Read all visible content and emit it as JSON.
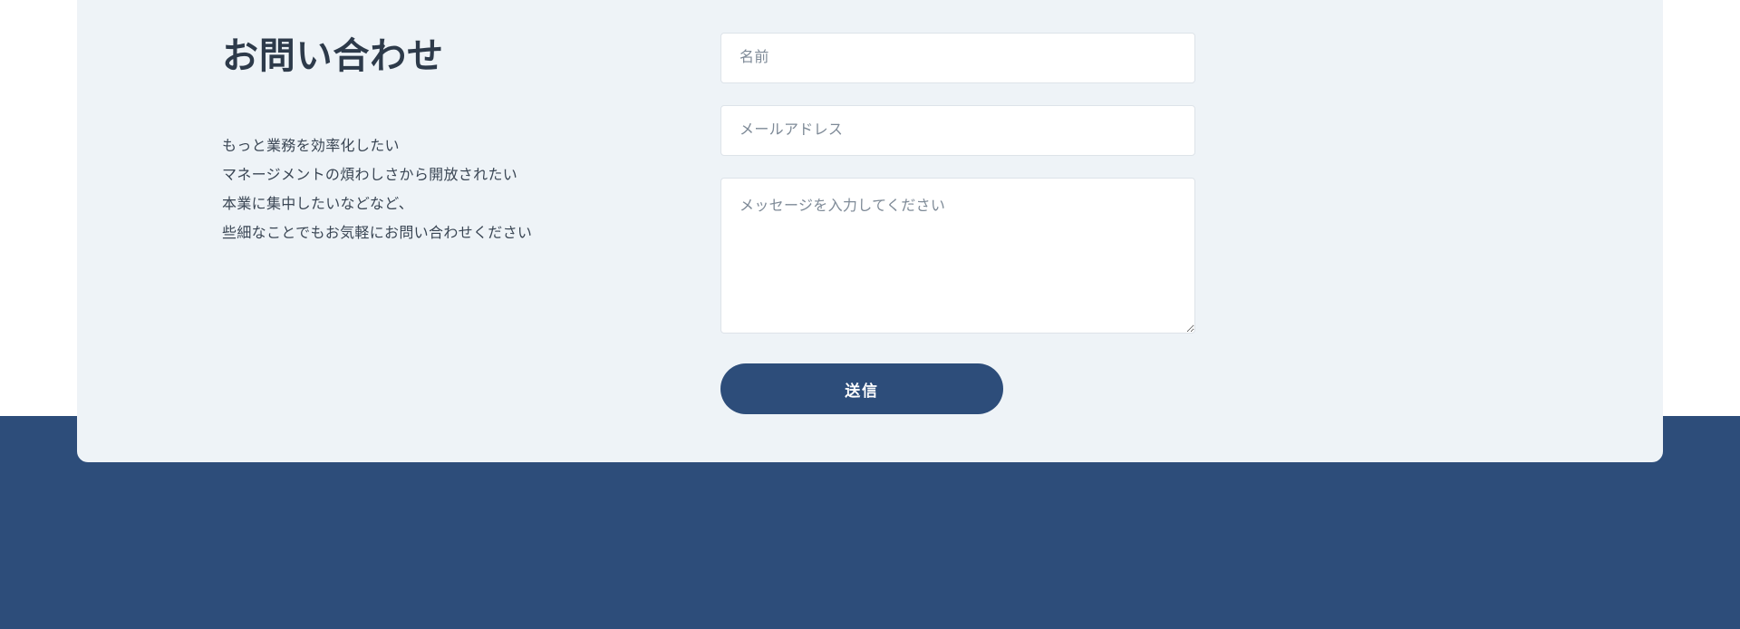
{
  "contact": {
    "heading": "お問い合わせ",
    "description": {
      "line1": "もっと業務を効率化したい",
      "line2": "マネージメントの煩わしさから開放されたい",
      "line3": "本業に集中したいなどなど、",
      "line4": "些細なことでもお気軽にお問い合わせください"
    },
    "form": {
      "name_placeholder": "名前",
      "email_placeholder": "メールアドレス",
      "message_placeholder": "メッセージを入力してください",
      "submit_label": "送信"
    }
  }
}
